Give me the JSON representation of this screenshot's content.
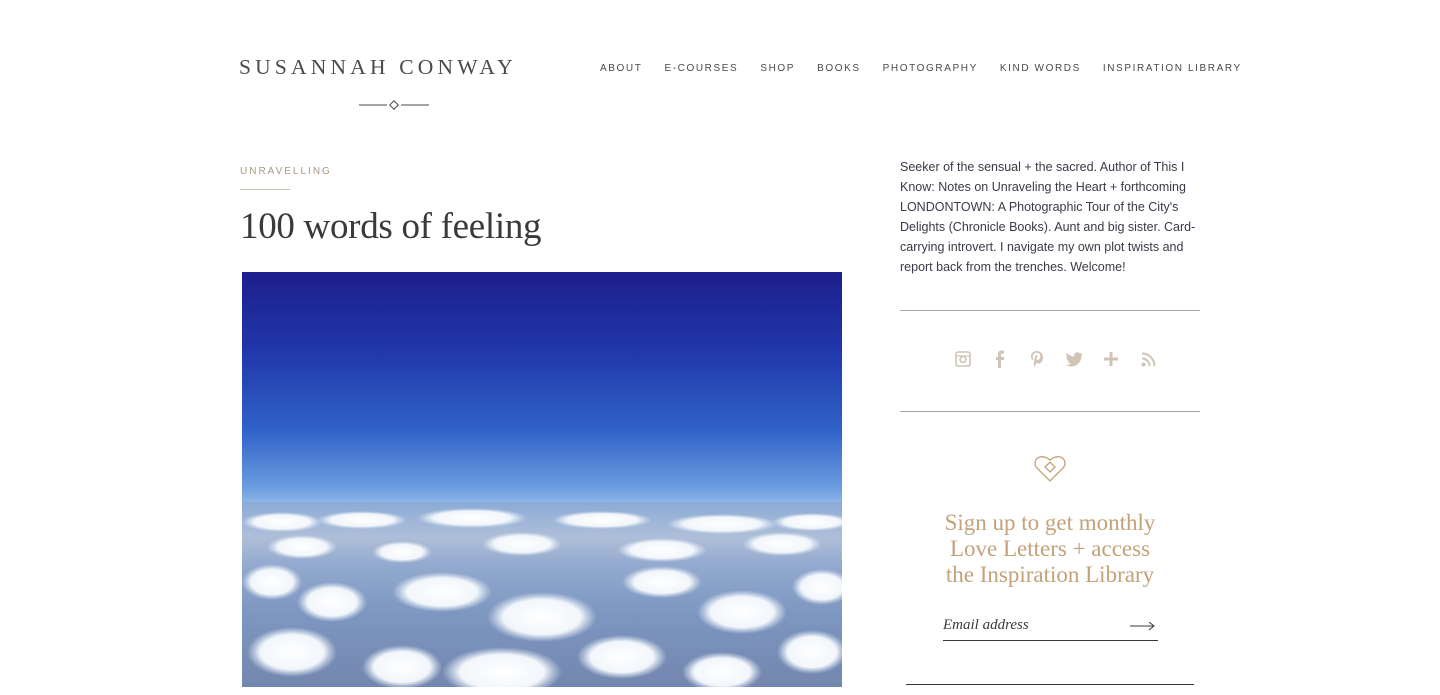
{
  "header": {
    "logo_text": "SUSANNAH CONWAY",
    "nav": [
      {
        "label": "ABOUT"
      },
      {
        "label": "E-COURSES"
      },
      {
        "label": "SHOP"
      },
      {
        "label": "BOOKS"
      },
      {
        "label": "PHOTOGRAPHY"
      },
      {
        "label": "KIND WORDS"
      },
      {
        "label": "INSPIRATION LIBRARY"
      }
    ]
  },
  "post": {
    "category": "UNRAVELLING",
    "title": "100 words of feeling"
  },
  "sidebar": {
    "bio": "Seeker of the sensual + the sacred. Author of This I Know: Notes on Unraveling the Heart + forthcoming LONDONTOWN: A Photographic Tour of the City's Delights (Chronicle Books). Aunt and big sister. Card-carrying introvert. I navigate my own plot twists and report back from the trenches. Welcome!",
    "social_icons": [
      "instagram-icon",
      "facebook-icon",
      "pinterest-icon",
      "twitter-icon",
      "plus-icon",
      "rss-icon"
    ],
    "signup": {
      "title_lines": [
        "Sign up to get monthly",
        "Love Letters + access",
        "the Inspiration Library"
      ],
      "email_placeholder": "Email address"
    }
  },
  "colors": {
    "accent_gold": "#c3a27a",
    "category_tan": "#a89a84",
    "social_icon": "#cfc4b6",
    "text_dark": "#3a3a3a"
  }
}
